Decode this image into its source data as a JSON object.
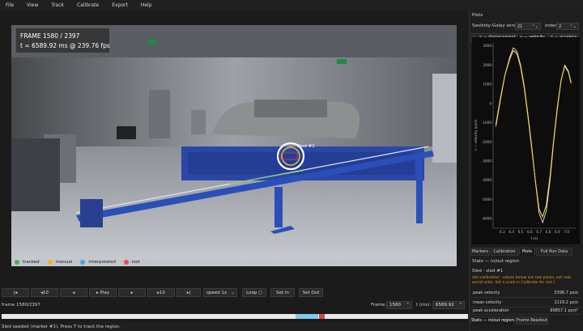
{
  "menu": [
    "File",
    "View",
    "Track",
    "Calibrate",
    "Export",
    "Help"
  ],
  "overlay": {
    "frame_line": "FRAME  1580 / 2397",
    "time_line": "t =  6589.92 ms   @ 239.76 fps"
  },
  "marker_label": "Sled #1",
  "legend": [
    {
      "label": "tracked",
      "color": "#4caf50"
    },
    {
      "label": "manual",
      "color": "#f2b01e"
    },
    {
      "label": "interpolated",
      "color": "#4aa3df"
    },
    {
      "label": "lost",
      "color": "#e05060"
    }
  ],
  "playback": {
    "start": "|◂",
    "back10": "◂10",
    "back1": "◂",
    "play": "▸ Play",
    "fwd1": "▸",
    "fwd10": "▸10",
    "end": "▸|",
    "speed": "speed 1x",
    "loop": "Loop ○",
    "set_in": "Set In",
    "set_out": "Set Out"
  },
  "frame_info": {
    "label": "frame 1580/2397",
    "frame_label": "Frame:",
    "frame_value": "1580",
    "t_label": "t (ms):",
    "t_value": "6589.92"
  },
  "status": "Sled seeded (marker #1). Press T to track the region.",
  "plots": {
    "title": "Plots",
    "sg_label": "Savitzky-Golay window",
    "sg_window": "21",
    "order_label": "order",
    "order_value": "2",
    "series_tabs": [
      "s — displacement",
      "v — velocity",
      "a — accelera"
    ],
    "ylabel": "v — velocity (px/s)",
    "xlabel": "t (s)"
  },
  "chart_data": {
    "type": "line",
    "title": "",
    "xlabel": "t (s)",
    "ylabel": "v — velocity (px/s)",
    "xlim": [
      6.2,
      7.1
    ],
    "ylim": [
      -6500,
      3200
    ],
    "x_ticks": [
      "6.3",
      "6.4",
      "6.5",
      "6.6",
      "6.7",
      "6.8",
      "6.9",
      "7.0"
    ],
    "y_ticks": [
      "3000",
      "2000",
      "1000",
      "0",
      "-1000",
      "-2000",
      "-3000",
      "-4000",
      "-5000",
      "-6000"
    ],
    "series": [
      {
        "color": "#e8e8e8",
        "x": [
          6.23,
          6.28,
          6.33,
          6.38,
          6.42,
          6.46,
          6.5,
          6.54,
          6.58,
          6.62,
          6.66,
          6.7,
          6.74,
          6.78,
          6.82,
          6.86,
          6.9,
          6.94,
          6.98,
          7.02,
          7.05
        ],
        "values": [
          -1200,
          200,
          1500,
          2400,
          2900,
          2700,
          2000,
          900,
          -600,
          -2200,
          -4000,
          -5700,
          -6200,
          -5600,
          -4000,
          -2000,
          -300,
          1200,
          2000,
          1700,
          1100
        ]
      },
      {
        "color": "#f3d44a",
        "x": [
          6.23,
          6.28,
          6.33,
          6.38,
          6.42,
          6.46,
          6.5,
          6.54,
          6.58,
          6.62,
          6.66,
          6.7,
          6.74,
          6.78,
          6.82,
          6.86,
          6.9,
          6.94,
          6.98,
          7.02,
          7.05
        ],
        "values": [
          -1100,
          300,
          1500,
          2300,
          2750,
          2600,
          1900,
          800,
          -700,
          -2300,
          -4000,
          -5500,
          -5900,
          -5300,
          -3800,
          -1900,
          -200,
          1200,
          1950,
          1650,
          1050
        ]
      }
    ]
  },
  "right_tabs": [
    "Markers",
    "Calibration",
    "Plots",
    "Full Run Data"
  ],
  "stats": {
    "header": "Stats — in/out region",
    "sled": "Sled · sled #1",
    "warning": "(Un-calibrated - values below are raw pixels, not real-world units. Set a scale in Calibrate for m/s.)",
    "rows": [
      {
        "label": "peak velocity",
        "value": "5396.7 px/s"
      },
      {
        "label": "mean velocity",
        "value": "2119.2 px/s"
      },
      {
        "label": "peak acceleration",
        "value": "99857.1 px/s²"
      }
    ]
  },
  "bottom_tabs": [
    "Stats — in/out region",
    "Frame Readout"
  ]
}
